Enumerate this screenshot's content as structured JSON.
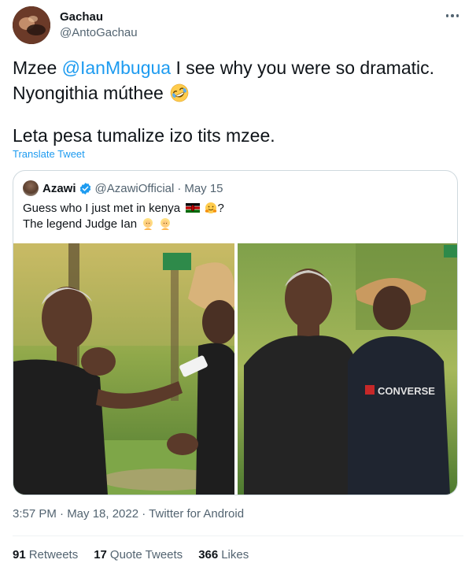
{
  "author": {
    "display_name": "Gachau",
    "handle": "@AntoGachau"
  },
  "tweet": {
    "line1_prefix": "Mzee ",
    "mention": "@IanMbugua",
    "line1_suffix": " I see why you were so dramatic.",
    "line2": "Nyongithia múthee",
    "line2_emoji": "rolling-on-floor-laughing-icon",
    "line3": "Leta pesa tumalize izo tits mzee.",
    "translate_label": "Translate Tweet"
  },
  "quoted_tweet": {
    "display_name": "Azawi",
    "handle": "@AzawiOfficial",
    "separator": "·",
    "date": "May 15",
    "line1": "Guess who I just met in kenya",
    "line1_suffix": "?",
    "line2": "The legend Judge Ian",
    "emojis": [
      "kenya-flag-icon",
      "hugging-face-icon",
      "blond-person-icon",
      "blond-person-icon"
    ]
  },
  "meta": {
    "timestamp": "3:57 PM · May 18, 2022 · ",
    "source": "Twitter for Android"
  },
  "stats": {
    "retweets_count": "91",
    "retweets_label": "Retweets",
    "quotes_count": "17",
    "quotes_label": "Quote Tweets",
    "likes_count": "366",
    "likes_label": "Likes"
  },
  "photo_text": {
    "shirt_brand": "CONVERSE"
  },
  "colors": {
    "link": "#1d9bf0",
    "secondary_text": "#536471",
    "border": "#cfd9de"
  }
}
